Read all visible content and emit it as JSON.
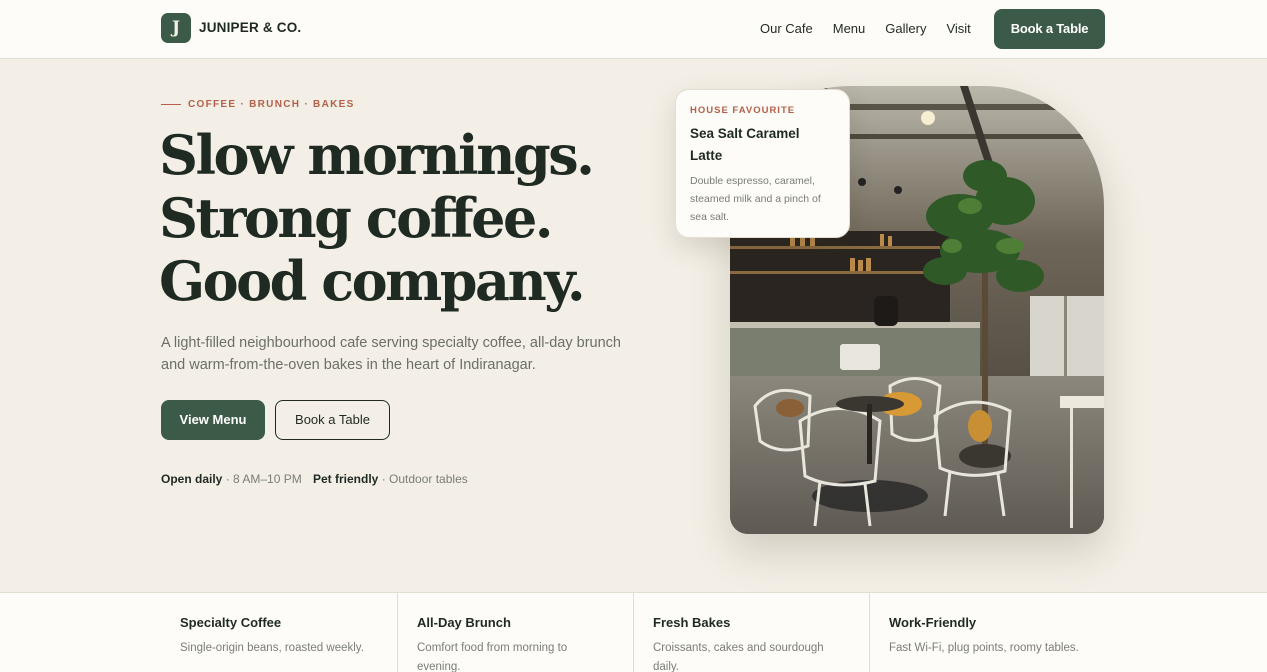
{
  "brand": {
    "mark": "J",
    "name": "JUNIPER & CO."
  },
  "nav": {
    "items": [
      "Our Cafe",
      "Menu",
      "Gallery",
      "Visit"
    ],
    "cta": "Book a Table"
  },
  "hero": {
    "eyebrow": "COFFEE · BRUNCH · BAKES",
    "headline": [
      "Slow mornings.",
      "Strong coffee.",
      "Good company."
    ],
    "description": "A light-filled neighbourhood cafe serving specialty coffee, all-day brunch and warm-from-the-oven bakes in the heart of Indiranagar.",
    "primary_button": "View Menu",
    "secondary_button": "Book a Table",
    "meta": [
      {
        "label": "Open daily",
        "value": " · 8 AM–10 PM"
      },
      {
        "label": "Pet friendly",
        "value": " · Outdoor tables"
      }
    ]
  },
  "favourite": {
    "label": "HOUSE FAVOURITE",
    "title": "Sea Salt Caramel Latte",
    "description": "Double espresso, caramel, steamed milk and a pinch of sea salt."
  },
  "features": [
    {
      "title": "Specialty Coffee",
      "text": "Single-origin beans, roasted weekly."
    },
    {
      "title": "All-Day Brunch",
      "text": "Comfort food from morning to evening."
    },
    {
      "title": "Fresh Bakes",
      "text": "Croissants, cakes and sourdough daily."
    },
    {
      "title": "Work-Friendly",
      "text": "Fast Wi-Fi, plug points, roomy tables."
    }
  ],
  "colors": {
    "accent": "#3c5a48",
    "eyebrow": "#b5604a",
    "background": "#f3efe6",
    "surface": "#fdfcf8",
    "text": "#1f2a22"
  }
}
